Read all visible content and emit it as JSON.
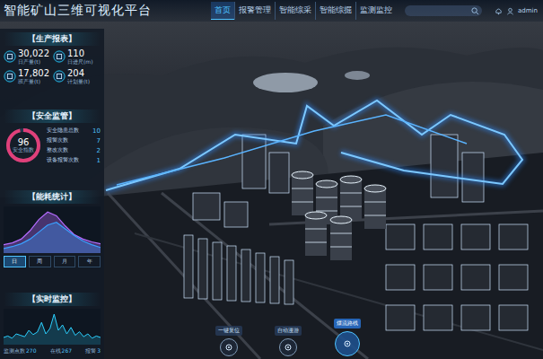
{
  "window": {
    "title": "智能矿山三维可视化平台"
  },
  "nav": [
    {
      "label": "首页",
      "selected": true
    },
    {
      "label": "报警管理",
      "selected": false
    },
    {
      "label": "智能综采",
      "selected": false
    },
    {
      "label": "智能综掘",
      "selected": false
    },
    {
      "label": "监测监控",
      "selected": false
    }
  ],
  "user": {
    "name": "admin"
  },
  "production": {
    "title": "【生产报表】",
    "stats": [
      {
        "value": "30,022",
        "label": "日产量(t)"
      },
      {
        "value": "110",
        "label": "日进尺(m)"
      },
      {
        "value": "17,802",
        "label": "班产量(t)"
      },
      {
        "value": "204",
        "label": "计划量(t)"
      }
    ]
  },
  "safety": {
    "title": "【安全监管】",
    "score": "96",
    "score_label": "安全指数",
    "level": 0.96,
    "items": [
      {
        "label": "安全隐患总数",
        "value": "10"
      },
      {
        "label": "报警次数",
        "value": "7"
      },
      {
        "label": "整改次数",
        "value": "2"
      },
      {
        "label": "设备报警次数",
        "value": "1"
      }
    ]
  },
  "energy": {
    "title": "【能耗统计】",
    "series": [
      {
        "values": [
          18,
          22,
          30,
          48,
          72,
          88,
          80,
          58,
          40,
          30,
          24,
          20
        ],
        "color": "#b56cff"
      },
      {
        "values": [
          10,
          14,
          20,
          30,
          45,
          60,
          66,
          52,
          38,
          26,
          18,
          12
        ],
        "color": "#3aa0ff"
      }
    ],
    "ranges": [
      {
        "label": "日",
        "selected": true
      },
      {
        "label": "周",
        "selected": false
      },
      {
        "label": "月",
        "selected": false
      },
      {
        "label": "年",
        "selected": false
      }
    ]
  },
  "monitor": {
    "title": "【实时监控】",
    "series": [
      {
        "values": [
          20,
          24,
          18,
          30,
          26,
          22,
          40,
          28,
          35,
          62,
          30,
          45,
          85,
          40,
          55,
          30,
          48,
          26,
          36,
          22,
          30,
          18,
          24,
          20
        ],
        "color": "#2bd0ff"
      }
    ],
    "stats": [
      {
        "label": "监测点数",
        "value": "270"
      },
      {
        "label": "在线",
        "value": "267"
      },
      {
        "label": "报警",
        "value": "3"
      }
    ]
  },
  "actions": [
    {
      "label": "一键复位",
      "selected": false
    },
    {
      "label": "自动漫游",
      "selected": false
    },
    {
      "label": "煤流路线",
      "selected": true
    }
  ]
}
